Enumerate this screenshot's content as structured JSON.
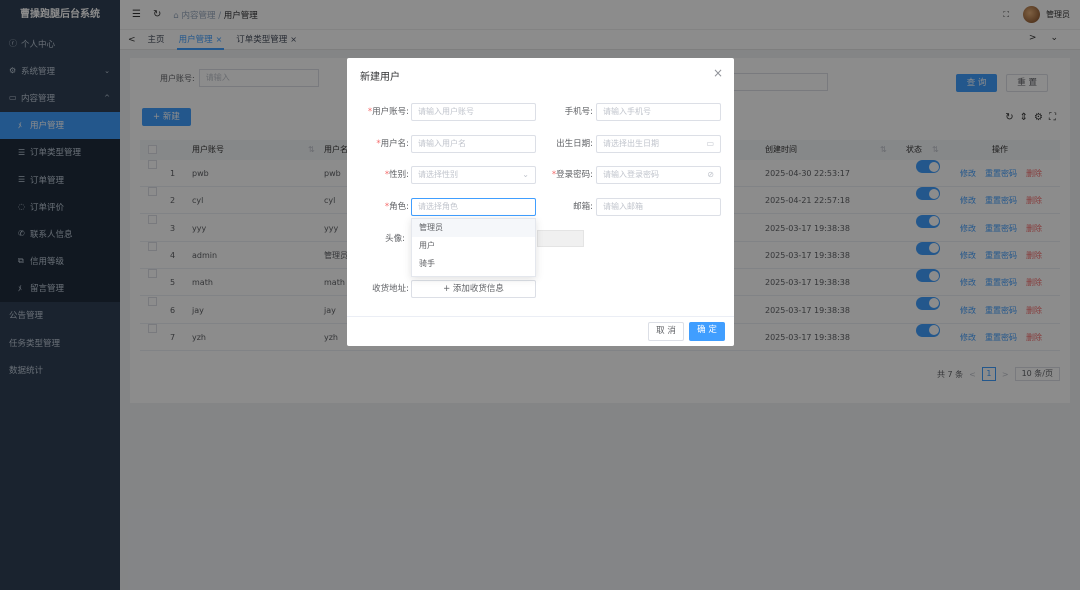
{
  "app_title": "曹操跑腿后台系统",
  "sidebar": {
    "items": [
      {
        "label": "个人中心",
        "icon": "user-icon"
      },
      {
        "label": "系统管理",
        "icon": "gear-icon",
        "arrow": "⌄"
      },
      {
        "label": "内容管理",
        "icon": "folder-icon",
        "arrow": "^"
      },
      {
        "label": "用户管理",
        "icon": "users-icon"
      },
      {
        "label": "订单类型管理",
        "icon": "list-icon"
      },
      {
        "label": "订单管理",
        "icon": "list-icon"
      },
      {
        "label": "订单评价",
        "icon": "comment-icon"
      },
      {
        "label": "联系人信息",
        "icon": "phone-icon"
      },
      {
        "label": "信用等级",
        "icon": "copy-icon"
      },
      {
        "label": "留言管理",
        "icon": "users-icon"
      },
      {
        "label": "公告管理",
        "icon": ""
      },
      {
        "label": "任务类型管理",
        "icon": ""
      },
      {
        "label": "数据统计",
        "icon": ""
      }
    ]
  },
  "navbar": {
    "crumb_home": "内容管理",
    "crumb_sep": "/",
    "crumb_current": "用户管理",
    "user": "管理员"
  },
  "tabs": [
    {
      "label": "主页"
    },
    {
      "label": "用户管理"
    },
    {
      "label": "订单类型管理"
    }
  ],
  "search": {
    "label": "用户账号:",
    "placeholder": "请输入",
    "query_btn": "查 询",
    "reset_btn": "重 置"
  },
  "toolbar": {
    "add_btn": "+ 新建"
  },
  "table": {
    "headers": [
      "用户账号",
      "用户名",
      "创建时间",
      "状态",
      "操作"
    ],
    "rows": [
      {
        "idx": "1",
        "account": "pwb",
        "name": "pwb",
        "created": "2025-04-30 22:53:17"
      },
      {
        "idx": "2",
        "account": "cyl",
        "name": "cyl",
        "created": "2025-04-21 22:57:18"
      },
      {
        "idx": "3",
        "account": "yyy",
        "name": "yyy",
        "created": "2025-03-17 19:38:38"
      },
      {
        "idx": "4",
        "account": "admin",
        "name": "管理员",
        "created": "2025-03-17 19:38:38"
      },
      {
        "idx": "5",
        "account": "math",
        "name": "math",
        "created": "2025-03-17 19:38:38"
      },
      {
        "idx": "6",
        "account": "jay",
        "name": "jay",
        "created": "2025-03-17 19:38:38"
      },
      {
        "idx": "7",
        "account": "yzh",
        "name": "yzh",
        "created": "2025-03-17 19:38:38"
      }
    ],
    "ops": {
      "edit": "修改",
      "reset": "重置密码",
      "del": "删除"
    }
  },
  "pager": {
    "total": "共 7 条",
    "prev": "<",
    "page": "1",
    "next": ">",
    "size": "10 条/页"
  },
  "dialog": {
    "title": "新建用户",
    "fields": {
      "account": {
        "label": "用户账号:",
        "placeholder": "请输入用户账号",
        "required": "*"
      },
      "phone": {
        "label": "手机号:",
        "placeholder": "请输入手机号"
      },
      "username": {
        "label": "用户名:",
        "placeholder": "请输入用户名",
        "required": "*"
      },
      "birthday": {
        "label": "出生日期:",
        "placeholder": "请选择出生日期"
      },
      "gender": {
        "label": "性别:",
        "placeholder": "请选择性别",
        "required": "*"
      },
      "password": {
        "label": "登录密码:",
        "placeholder": "请输入登录密码",
        "required": "*"
      },
      "role": {
        "label": "角色:",
        "placeholder": "请选择角色",
        "required": "*"
      },
      "email": {
        "label": "邮箱:",
        "placeholder": "请输入邮箱"
      },
      "avatar": {
        "label": "头像:"
      },
      "address": {
        "label": "收货地址:",
        "button": "+ 添加收货信息"
      }
    },
    "role_options": [
      "管理员",
      "用户",
      "骑手"
    ],
    "cancel": "取 消",
    "confirm": "确 定"
  }
}
